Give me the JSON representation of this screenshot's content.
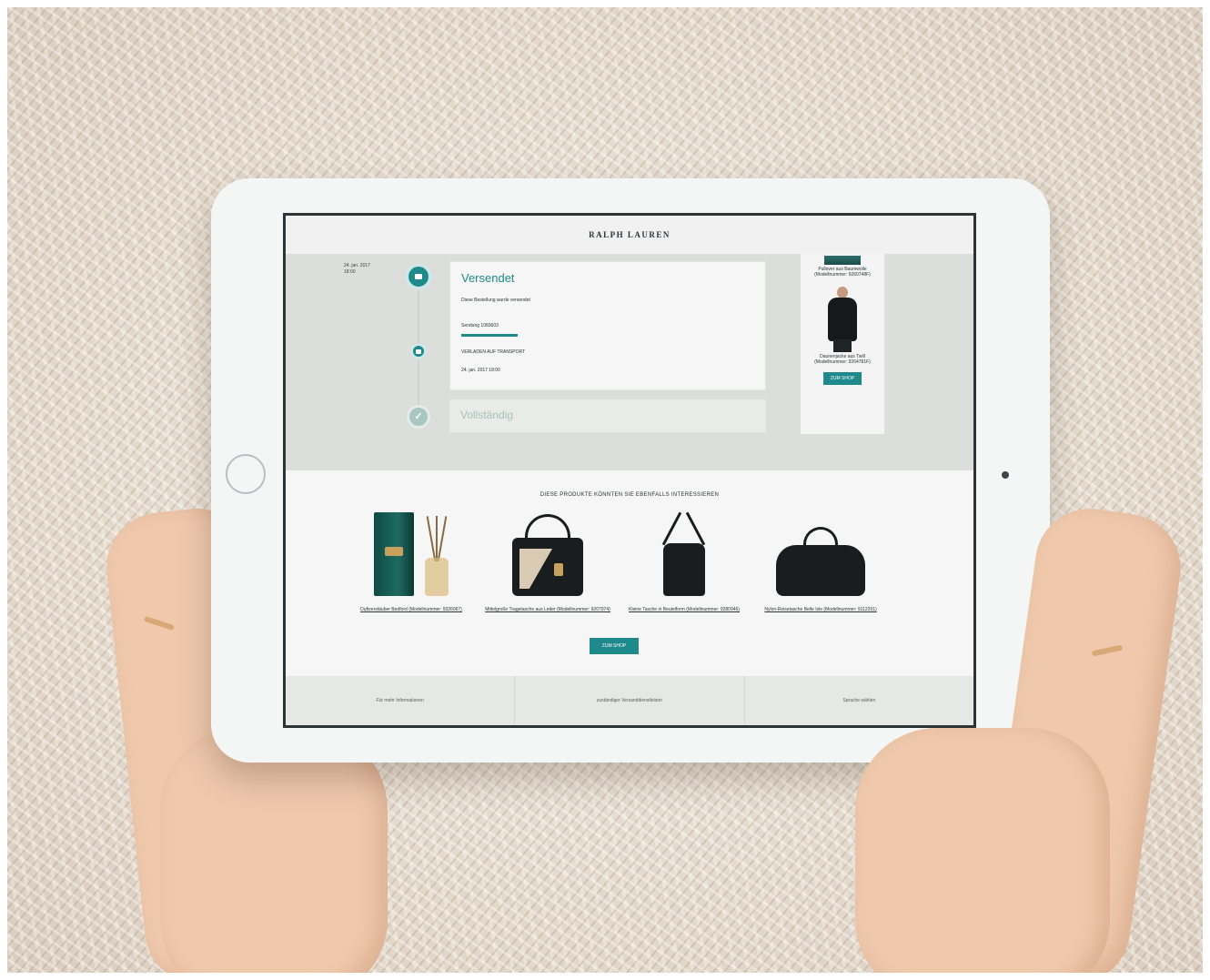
{
  "header": {
    "brand": "RALPH LAUREN"
  },
  "tracking": {
    "date": "24. jan. 2017",
    "time": "18:00",
    "shipped_title": "Versendet",
    "shipped_message": "Diese Bestellung wurde versendet",
    "shipment_label": "Sendung 1083603",
    "status_label": "VERLADEN AUF TRANSPORT",
    "status_date": "24. jan. 2017 18:00",
    "complete_title": "Vollständig"
  },
  "sidebar": {
    "items": [
      {
        "caption": "Pullover aus Baumwolle (Modellnummer: 9260748F)"
      },
      {
        "caption": "Daunenjacke aus Twill (Modellnummer: 9264781F)"
      }
    ],
    "shop_button": "ZUM SHOP"
  },
  "recommendations": {
    "title": "DIESE PRODUKTE KÖNNTEN SIE EBENFALLS INTERESSIEREN",
    "products": [
      {
        "caption": "Duftzerstäuber Bedford (Modellnummer: 9326067)"
      },
      {
        "caption": "Mittelgroße Tragetasche aus Leder (Modellnummer: 9207974)"
      },
      {
        "caption": "Kleine Tasche in Beutelform (Modellnummer: 9280946)"
      },
      {
        "caption": "Nylon-Reisetasche Belle Isle (Modellnummer: 9112291)"
      }
    ],
    "shop_button": "ZUM SHOP"
  },
  "footer": {
    "links": [
      "Für mehr Informationen",
      "zuständiger Versanddienstleister",
      "Sprache wählen"
    ]
  },
  "colors": {
    "accent": "#1e8a8c",
    "complete_muted": "#a9c6c3",
    "text_dark": "#2e3335"
  }
}
